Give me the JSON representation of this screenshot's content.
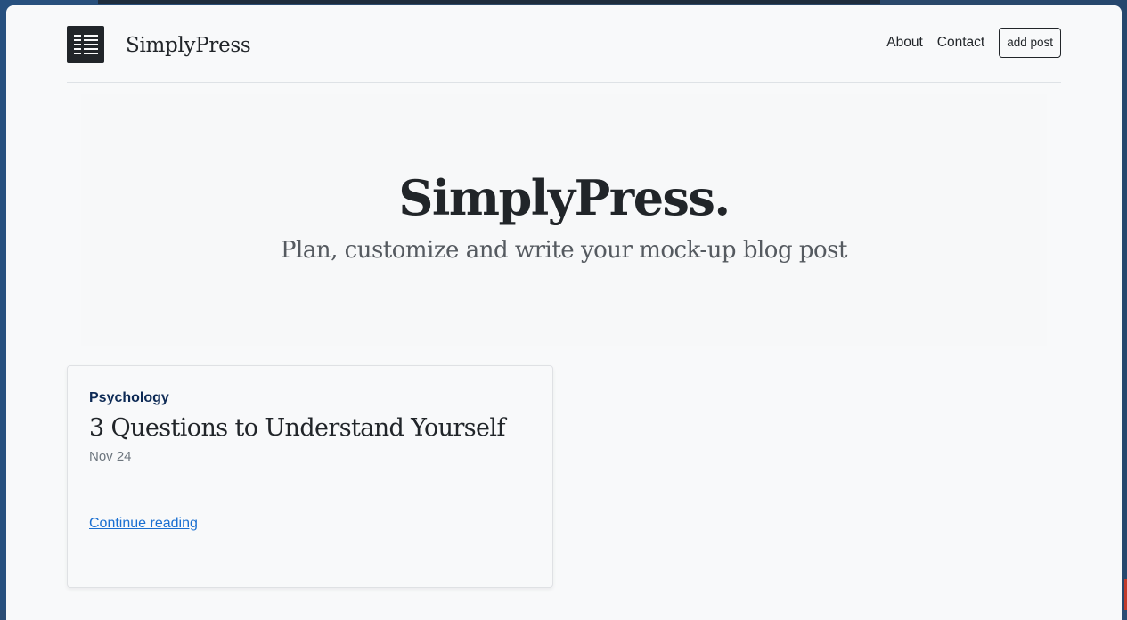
{
  "header": {
    "site_name": "SimplyPress",
    "nav": {
      "about_label": "About",
      "contact_label": "Contact",
      "add_post_label": "add post"
    }
  },
  "hero": {
    "title": "SimplyPress.",
    "subtitle": "Plan, customize and write your mock-up blog post"
  },
  "posts": [
    {
      "category": "Psychology",
      "title": "3 Questions to Understand Yourself",
      "date": "Nov 24",
      "link_label": "Continue reading"
    }
  ],
  "icons": {
    "logo": "document-lines-icon"
  },
  "colors": {
    "page_background": "#f8f9fa",
    "logo_background": "#212529",
    "category_text": "#0d2a55",
    "link": "#1a6fd1"
  }
}
